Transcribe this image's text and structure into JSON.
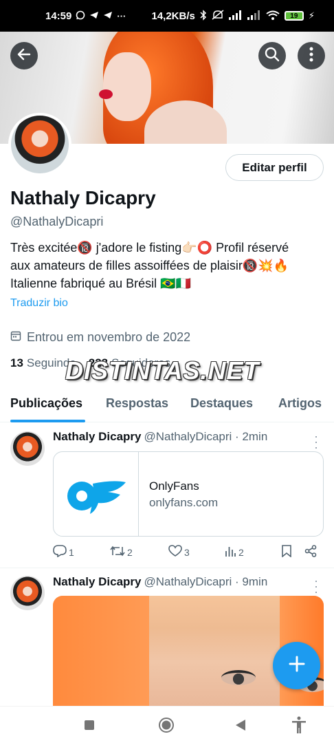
{
  "status_bar": {
    "time": "14:59",
    "net_speed": "14,2KB/s",
    "battery": "19",
    "left_icons": [
      "whatsapp-icon",
      "telegram-icon",
      "telegram-icon",
      "more-dots"
    ],
    "right_icons": [
      "bluetooth-icon",
      "mute-icon",
      "signal-icon",
      "signal-icon",
      "wifi-icon",
      "battery-icon",
      "charging-icon"
    ]
  },
  "header": {
    "back_icon": "arrow-left-icon",
    "search_icon": "search-icon",
    "more_icon": "more-vertical-icon"
  },
  "profile": {
    "edit_button": "Editar perfil",
    "display_name": "Nathaly Dicapry",
    "handle": "@NathalyDicapri",
    "bio_line1": "Très excitée🔞 j'adore le fisting👉🏻⭕ Profil réservé",
    "bio_line2": "aux amateurs de filles assoiffées de plaisir🔞💥🔥",
    "bio_line3": "Italienne fabriqué au Brésil 🇧🇷🇮🇹",
    "translate_bio": "Traduzir bio",
    "joined": "Entrou em novembro de 2022",
    "following_count": "13",
    "following_label": "Seguindo",
    "followers_count": "223",
    "followers_label": "Seguidores"
  },
  "watermark": "DISTINTAS.NET",
  "tabs": [
    {
      "label": "Publicações",
      "active": true
    },
    {
      "label": "Respostas",
      "active": false
    },
    {
      "label": "Destaques",
      "active": false
    },
    {
      "label": "Artigos",
      "active": false
    }
  ],
  "tweets": [
    {
      "name": "Nathaly Dicapry",
      "handle": "@NathalyDicapri",
      "time": "· 2min",
      "card": {
        "title": "OnlyFans",
        "domain": "onlyfans.com"
      },
      "replies": "1",
      "retweets": "2",
      "likes": "3",
      "views": "2"
    },
    {
      "name": "Nathaly Dicapry",
      "handle": "@NathalyDicapri",
      "time": "· 9min"
    }
  ],
  "fab": {
    "icon": "plus-icon"
  },
  "nav": [
    "recents-square-icon",
    "home-circle-icon",
    "back-triangle-icon",
    "accessibility-icon"
  ],
  "colors": {
    "accent": "#1d9bf0",
    "text": "#0f1419",
    "secondary": "#536471",
    "border": "#cfd9de"
  }
}
